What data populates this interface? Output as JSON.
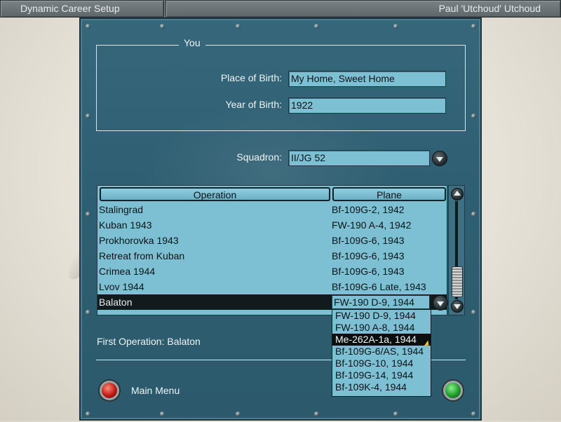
{
  "topbar": {
    "title": "Dynamic Career Setup",
    "player": "Paul 'Utchoud' Utchoud"
  },
  "you": {
    "group_title": "You",
    "place_label": "Place of Birth:",
    "place_value": "My Home, Sweet Home",
    "year_label": "Year of Birth:",
    "year_value": "1922"
  },
  "squadron": {
    "label": "Squadron:",
    "value": "II/JG 52",
    "dropdown_icon": "chevron-down-icon"
  },
  "table": {
    "columns": [
      "Operation",
      "Plane"
    ],
    "rows": [
      {
        "operation": "Stalingrad",
        "plane": "Bf-109G-2, 1942"
      },
      {
        "operation": "Kuban 1943",
        "plane": "FW-190 A-4, 1942"
      },
      {
        "operation": "Prokhorovka 1943",
        "plane": "Bf-109G-6, 1943"
      },
      {
        "operation": "Retreat from Kuban",
        "plane": "Bf-109G-6, 1943"
      },
      {
        "operation": "Crimea 1944",
        "plane": "Bf-109G-6, 1943"
      },
      {
        "operation": "Lvov 1944",
        "plane": "Bf-109G-6 Late, 1943"
      },
      {
        "operation": "Balaton",
        "plane": "FW-190 D-9, 1944",
        "selected": true
      }
    ]
  },
  "plane_dropdown": {
    "options": [
      "FW-190 D-9, 1944",
      "FW-190 A-8, 1944",
      "Me-262A-1a, 1944",
      "Bf-109G-6/AS, 1944",
      "Bf-109G-10, 1944",
      "Bf-109G-14, 1944",
      "Bf-109K-4, 1944"
    ],
    "highlighted_index": 2
  },
  "footer": {
    "first_operation": "First Operation: Balaton",
    "main_menu": "Main Menu"
  },
  "colors": {
    "panel": "#2f5f72",
    "field": "#7ec0d3",
    "selection": "#121a1d",
    "red_button": "#c01a12",
    "green_button": "#1e9b2b"
  }
}
